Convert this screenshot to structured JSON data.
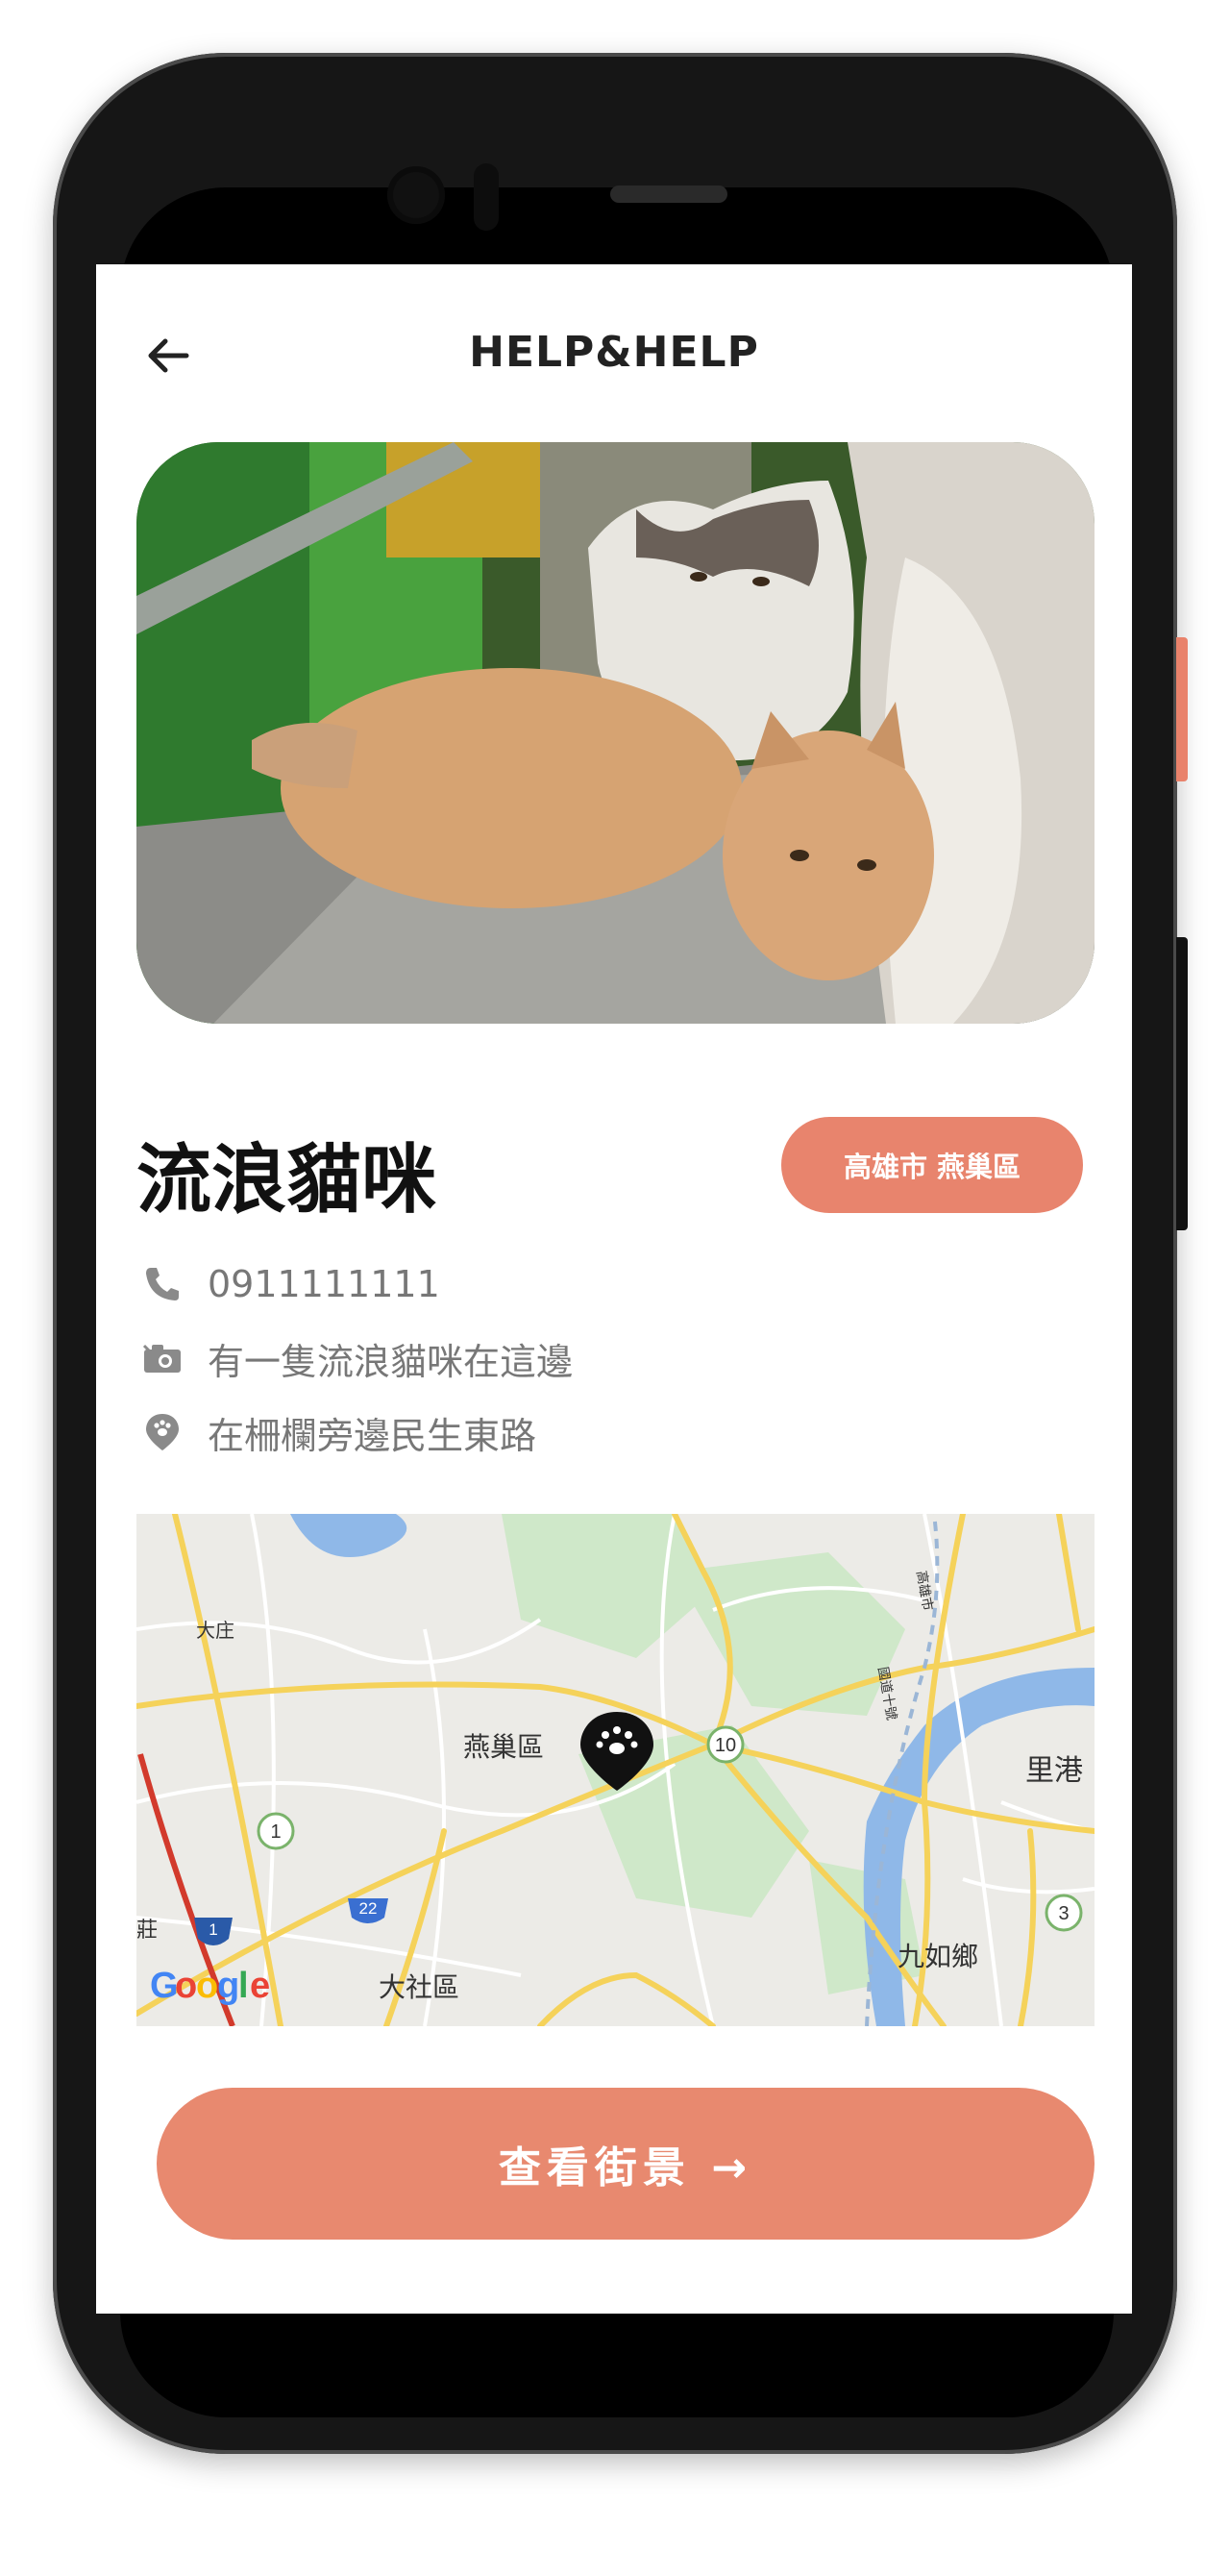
{
  "app": {
    "title": "HELP&HELP"
  },
  "report": {
    "title": "流浪貓咪",
    "district": "高雄市 燕巢區",
    "phone": "0911111111",
    "description": "有一隻流浪貓咪在這邊",
    "location": "在柵欄旁邊民生東路"
  },
  "map": {
    "labels": {
      "dazhuang": "大庄",
      "yanchao": "燕巢區",
      "ligang": "里港",
      "jiuru": "九如鄉",
      "dashe": "大社區",
      "zhuang": "莊",
      "highway": "高雄市",
      "fwy": "國道十號"
    },
    "shields": {
      "r1": "1",
      "r10": "10",
      "r22": "22",
      "r3": "3",
      "i1": "1"
    },
    "google_letters": [
      "G",
      "o",
      "o",
      "g",
      "l",
      "e"
    ],
    "pin_icon": "paw-icon"
  },
  "actions": {
    "street_view": "查看街景 →"
  },
  "colors": {
    "accent": "#e8846d",
    "map_road": "#f5d25a",
    "map_green": "#cfe8c9",
    "map_water": "#8fb8e8"
  }
}
